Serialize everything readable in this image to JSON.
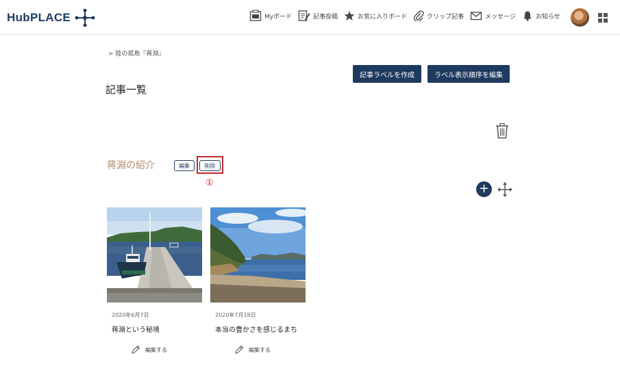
{
  "header": {
    "logo_text": "HubPLACE",
    "nav": [
      {
        "label": "Myボード",
        "icon": "board-icon"
      },
      {
        "label": "記事投稿",
        "icon": "post-icon"
      },
      {
        "label": "お気に入りボード",
        "icon": "star-icon"
      },
      {
        "label": "クリップ記事",
        "icon": "clip-icon"
      },
      {
        "label": "メッセージ",
        "icon": "mail-icon"
      },
      {
        "label": "お知らせ",
        "icon": "bell-icon"
      }
    ]
  },
  "breadcrumb": "> 陸の孤島『蒋淵』",
  "page_title": "記事一覧",
  "actions": {
    "create_label": "記事ラベルを作成",
    "reorder_label": "ラベル表示順序を編集"
  },
  "label_section": {
    "title": "蒋淵の紹介",
    "edit_label": "編集",
    "delete_label": "削除",
    "annotation": "①"
  },
  "cards": [
    {
      "date": "2020年6月7日",
      "title": "蒋淵という秘境",
      "edit_label": "編集する"
    },
    {
      "date": "2020年7月18日",
      "title": "本当の豊かさを感じるまち",
      "edit_label": "編集する"
    }
  ],
  "colors": {
    "accent": "#1f3a5f",
    "label_title": "#b08a68",
    "highlight": "#c0282d"
  }
}
